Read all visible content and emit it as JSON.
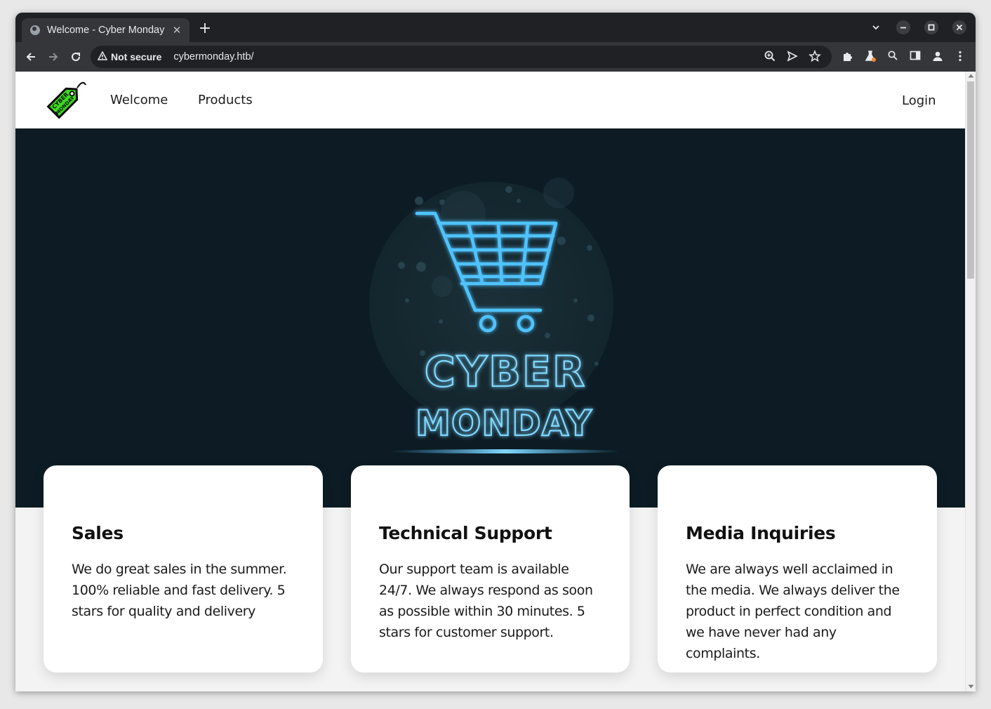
{
  "browser": {
    "tab_title": "Welcome - Cyber Monday",
    "tab_close": "✕",
    "new_tab": "+",
    "security_label": "Not secure",
    "url": "cybermonday.htb/",
    "icons": [
      "back-icon",
      "forward-icon",
      "reload-icon",
      "zoom-icon",
      "send-icon",
      "star-icon",
      "extensions-icon",
      "labs-icon",
      "search-icon",
      "side-panel-icon",
      "profile-icon",
      "menu-icon"
    ]
  },
  "site": {
    "logo_text": "CYBER MONDAY",
    "nav": {
      "welcome": "Welcome",
      "products": "Products",
      "login": "Login"
    },
    "hero": {
      "line1": "CYBER",
      "line2": "MONDAY"
    },
    "cards": [
      {
        "title": "Sales",
        "body": "We do great sales in the summer. 100% reliable and fast delivery. 5 stars for quality and delivery"
      },
      {
        "title": "Technical Support",
        "body": "Our support team is available 24/7. We always respond as soon as possible within 30 minutes. 5 stars for customer support."
      },
      {
        "title": "Media Inquiries",
        "body": "We are always well acclaimed in the media. We always deliver the product in perfect condition and we have never had any complaints."
      }
    ]
  },
  "colors": {
    "hero_bg": "#0d1c24",
    "neon": "#4fc3ff",
    "logo_green": "#3ddc1e"
  }
}
